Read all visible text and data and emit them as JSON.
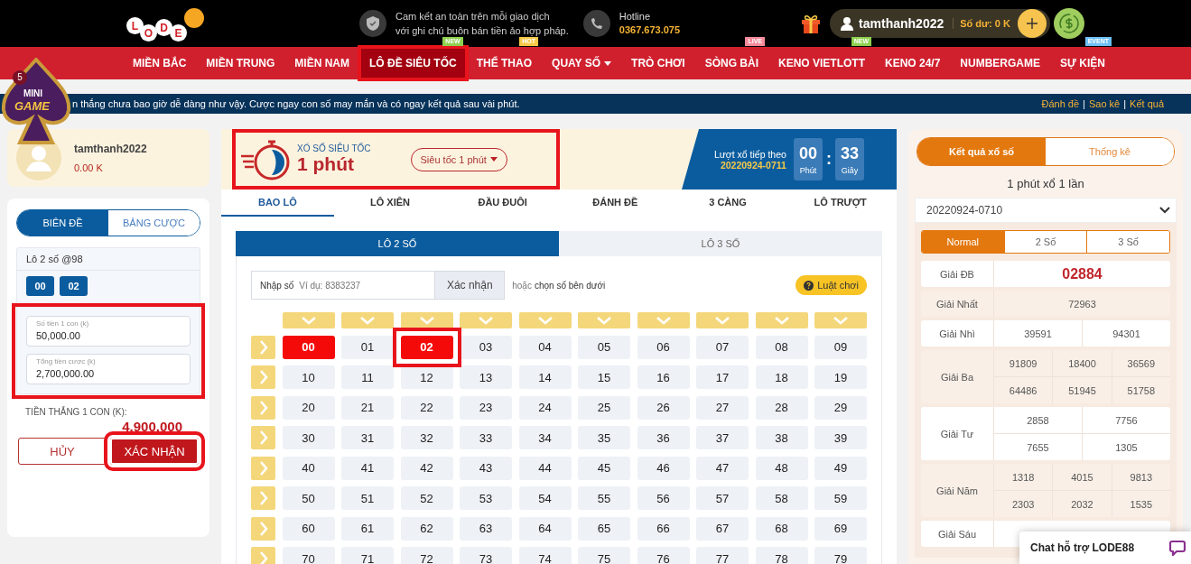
{
  "logo": {
    "letters": [
      "L",
      "O",
      "D",
      "E"
    ]
  },
  "mini_game": {
    "count": "5",
    "label": [
      "MINI",
      "GAME"
    ]
  },
  "header": {
    "notice": [
      "Cam kết an toàn trên mỗi giao dịch",
      "với ghi chú buôn bán tiền ảo hợp pháp."
    ],
    "hotline_label": "Hotline",
    "hotline": "0367.673.075",
    "username": "tamthanh2022",
    "balance": "Số dư: 0 K"
  },
  "nav": [
    {
      "label": "MIỀN BẮC",
      "selected": false,
      "highlighted": false,
      "dropdown": false
    },
    {
      "label": "MIỀN TRUNG",
      "selected": false,
      "highlighted": false,
      "dropdown": false
    },
    {
      "label": "MIỀN NAM",
      "selected": false,
      "highlighted": false,
      "dropdown": false
    },
    {
      "label": "LÔ ĐỀ SIÊU TỐC",
      "selected": true,
      "highlighted": true,
      "dropdown": false,
      "badge": {
        "text": "NEW",
        "color": "#8fd14f"
      }
    },
    {
      "label": "THỂ THAO",
      "selected": false,
      "highlighted": false,
      "dropdown": false,
      "badge": {
        "text": "HOT",
        "color": "#f7c948"
      }
    },
    {
      "label": "QUAY SỐ",
      "selected": false,
      "highlighted": false,
      "dropdown": true
    },
    {
      "label": "TRÒ CHƠI",
      "selected": false,
      "highlighted": false,
      "dropdown": false
    },
    {
      "label": "SÒNG BÀI",
      "selected": false,
      "highlighted": false,
      "dropdown": false,
      "badge": {
        "text": "LIVE",
        "color": "#f58a9a"
      }
    },
    {
      "label": "KENO VIETLOTT",
      "selected": false,
      "highlighted": false,
      "dropdown": false,
      "badge": {
        "text": "NEW",
        "color": "#8fd14f"
      }
    },
    {
      "label": "KENO 24/7",
      "selected": false,
      "highlighted": false,
      "dropdown": false
    },
    {
      "label": "NUMBERGAME",
      "selected": false,
      "highlighted": false,
      "dropdown": false
    },
    {
      "label": "SỰ KIỆN",
      "selected": false,
      "highlighted": false,
      "dropdown": false,
      "badge": {
        "text": "EVENT",
        "color": "#6ec1f5"
      }
    }
  ],
  "marquee": {
    "text": "n thắng chưa bao giờ dễ dàng như vậy. Cược ngay con số may mắn và có ngay kết quả sau vài phút.",
    "links": [
      "Đánh đề",
      "Sao kê",
      "Kết quả"
    ],
    "separator": "|"
  },
  "profile": {
    "username": "tamthanh2022",
    "balance": "0.00 K"
  },
  "bet_panel": {
    "tabs": [
      {
        "label": "BIÊN ĐỀ",
        "selected": true
      },
      {
        "label": "BẢNG CƯỢC",
        "selected": false
      }
    ],
    "title": "Lô 2 số @98",
    "chosen": [
      "00",
      "02"
    ],
    "fields_highlighted": true,
    "fields": [
      {
        "label": "Số tiền 1 con (k)",
        "value": "50,000.00"
      },
      {
        "label": "Tổng tiền cược (k)",
        "value": "2,700,000.00"
      }
    ],
    "win_label": "TIỀN THẮNG 1 CON (K):",
    "win_amount": "4.900.000",
    "cancel": "HỦY",
    "confirm": {
      "label": "XÁC NHẬN",
      "highlighted": true
    }
  },
  "game": {
    "highlighted": true,
    "kicker": "XỔ SỐ SIÊU TỐC",
    "title": "1 phút",
    "mode": "Siêu tốc 1 phút",
    "next_label": "Lượt xổ tiếp theo",
    "next_id": "20220924-0711",
    "countdown": [
      {
        "value": "00",
        "unit": "Phút"
      },
      {
        "value": "33",
        "unit": "Giây"
      }
    ],
    "countdown_separator": ":"
  },
  "bet_tabs": [
    {
      "label": "BAO LÔ",
      "selected": true
    },
    {
      "label": "LÔ XIÊN",
      "selected": false
    },
    {
      "label": "ĐẦU ĐUÔI",
      "selected": false
    },
    {
      "label": "ĐÁNH ĐỀ",
      "selected": false
    },
    {
      "label": "3 CÀNG",
      "selected": false
    },
    {
      "label": "LÔ TRƯỢT",
      "selected": false
    }
  ],
  "sub_tabs": [
    {
      "label": "LÔ 2 SỐ",
      "selected": true
    },
    {
      "label": "LÔ 3 SỐ",
      "selected": false
    }
  ],
  "entry": {
    "label": "Nhập số",
    "placeholder": "Ví dụ: 8383237",
    "button": "Xác nhận",
    "hint": "hoặc",
    "hint_strong": "chọn số bên dưới",
    "rules": "Luật chơi"
  },
  "grid": [
    [
      {
        "n": "00",
        "selected": true,
        "highlighted": false
      },
      {
        "n": "01",
        "selected": false,
        "highlighted": false
      },
      {
        "n": "02",
        "selected": true,
        "highlighted": true
      },
      {
        "n": "03",
        "selected": false,
        "highlighted": false
      },
      {
        "n": "04",
        "selected": false,
        "highlighted": false
      },
      {
        "n": "05",
        "selected": false,
        "highlighted": false
      },
      {
        "n": "06",
        "selected": false,
        "highlighted": false
      },
      {
        "n": "07",
        "selected": false,
        "highlighted": false
      },
      {
        "n": "08",
        "selected": false,
        "highlighted": false
      },
      {
        "n": "09",
        "selected": false,
        "highlighted": false
      }
    ],
    [
      {
        "n": "10",
        "selected": false,
        "highlighted": false
      },
      {
        "n": "11",
        "selected": false,
        "highlighted": false
      },
      {
        "n": "12",
        "selected": false,
        "highlighted": false
      },
      {
        "n": "13",
        "selected": false,
        "highlighted": false
      },
      {
        "n": "14",
        "selected": false,
        "highlighted": false
      },
      {
        "n": "15",
        "selected": false,
        "highlighted": false
      },
      {
        "n": "16",
        "selected": false,
        "highlighted": false
      },
      {
        "n": "17",
        "selected": false,
        "highlighted": false
      },
      {
        "n": "18",
        "selected": false,
        "highlighted": false
      },
      {
        "n": "19",
        "selected": false,
        "highlighted": false
      }
    ],
    [
      {
        "n": "20",
        "selected": false,
        "highlighted": false
      },
      {
        "n": "21",
        "selected": false,
        "highlighted": false
      },
      {
        "n": "22",
        "selected": false,
        "highlighted": false
      },
      {
        "n": "23",
        "selected": false,
        "highlighted": false
      },
      {
        "n": "24",
        "selected": false,
        "highlighted": false
      },
      {
        "n": "25",
        "selected": false,
        "highlighted": false
      },
      {
        "n": "26",
        "selected": false,
        "highlighted": false
      },
      {
        "n": "27",
        "selected": false,
        "highlighted": false
      },
      {
        "n": "28",
        "selected": false,
        "highlighted": false
      },
      {
        "n": "29",
        "selected": false,
        "highlighted": false
      }
    ],
    [
      {
        "n": "30",
        "selected": false,
        "highlighted": false
      },
      {
        "n": "31",
        "selected": false,
        "highlighted": false
      },
      {
        "n": "32",
        "selected": false,
        "highlighted": false
      },
      {
        "n": "33",
        "selected": false,
        "highlighted": false
      },
      {
        "n": "34",
        "selected": false,
        "highlighted": false
      },
      {
        "n": "35",
        "selected": false,
        "highlighted": false
      },
      {
        "n": "36",
        "selected": false,
        "highlighted": false
      },
      {
        "n": "37",
        "selected": false,
        "highlighted": false
      },
      {
        "n": "38",
        "selected": false,
        "highlighted": false
      },
      {
        "n": "39",
        "selected": false,
        "highlighted": false
      }
    ],
    [
      {
        "n": "40",
        "selected": false,
        "highlighted": false
      },
      {
        "n": "41",
        "selected": false,
        "highlighted": false
      },
      {
        "n": "42",
        "selected": false,
        "highlighted": false
      },
      {
        "n": "43",
        "selected": false,
        "highlighted": false
      },
      {
        "n": "44",
        "selected": false,
        "highlighted": false
      },
      {
        "n": "45",
        "selected": false,
        "highlighted": false
      },
      {
        "n": "46",
        "selected": false,
        "highlighted": false
      },
      {
        "n": "47",
        "selected": false,
        "highlighted": false
      },
      {
        "n": "48",
        "selected": false,
        "highlighted": false
      },
      {
        "n": "49",
        "selected": false,
        "highlighted": false
      }
    ],
    [
      {
        "n": "50",
        "selected": false,
        "highlighted": false
      },
      {
        "n": "51",
        "selected": false,
        "highlighted": false
      },
      {
        "n": "52",
        "selected": false,
        "highlighted": false
      },
      {
        "n": "53",
        "selected": false,
        "highlighted": false
      },
      {
        "n": "54",
        "selected": false,
        "highlighted": false
      },
      {
        "n": "55",
        "selected": false,
        "highlighted": false
      },
      {
        "n": "56",
        "selected": false,
        "highlighted": false
      },
      {
        "n": "57",
        "selected": false,
        "highlighted": false
      },
      {
        "n": "58",
        "selected": false,
        "highlighted": false
      },
      {
        "n": "59",
        "selected": false,
        "highlighted": false
      }
    ],
    [
      {
        "n": "60",
        "selected": false,
        "highlighted": false
      },
      {
        "n": "61",
        "selected": false,
        "highlighted": false
      },
      {
        "n": "62",
        "selected": false,
        "highlighted": false
      },
      {
        "n": "63",
        "selected": false,
        "highlighted": false
      },
      {
        "n": "64",
        "selected": false,
        "highlighted": false
      },
      {
        "n": "65",
        "selected": false,
        "highlighted": false
      },
      {
        "n": "66",
        "selected": false,
        "highlighted": false
      },
      {
        "n": "67",
        "selected": false,
        "highlighted": false
      },
      {
        "n": "68",
        "selected": false,
        "highlighted": false
      },
      {
        "n": "69",
        "selected": false,
        "highlighted": false
      }
    ],
    [
      {
        "n": "70",
        "selected": false,
        "highlighted": false
      },
      {
        "n": "71",
        "selected": false,
        "highlighted": false
      },
      {
        "n": "72",
        "selected": false,
        "highlighted": false
      },
      {
        "n": "73",
        "selected": false,
        "highlighted": false
      },
      {
        "n": "74",
        "selected": false,
        "highlighted": false
      },
      {
        "n": "75",
        "selected": false,
        "highlighted": false
      },
      {
        "n": "76",
        "selected": false,
        "highlighted": false
      },
      {
        "n": "77",
        "selected": false,
        "highlighted": false
      },
      {
        "n": "78",
        "selected": false,
        "highlighted": false
      },
      {
        "n": "79",
        "selected": false,
        "highlighted": false
      }
    ]
  ],
  "results": {
    "tabs": [
      {
        "label": "Kết quả xổ số",
        "selected": true
      },
      {
        "label": "Thống kê",
        "selected": false
      }
    ],
    "frequency": "1 phút xổ 1 lần",
    "draw": "20220924-0710",
    "modes": [
      {
        "label": "Normal",
        "selected": true
      },
      {
        "label": "2 Số",
        "selected": false
      },
      {
        "label": "3 Số",
        "selected": false
      }
    ],
    "prizes": [
      {
        "label": "Giải ĐB",
        "kind": "special",
        "rows": [
          [
            "02884"
          ]
        ]
      },
      {
        "label": "Giải Nhất",
        "kind": "normal",
        "rows": [
          [
            "72963"
          ]
        ]
      },
      {
        "label": "Giải Nhì",
        "kind": "normal",
        "rows": [
          [
            "39591",
            "94301"
          ]
        ]
      },
      {
        "label": "Giải Ba",
        "kind": "normal",
        "rows": [
          [
            "91809",
            "18400",
            "36569"
          ],
          [
            "64486",
            "51945",
            "51758"
          ]
        ]
      },
      {
        "label": "Giải Tư",
        "kind": "normal",
        "rows": [
          [
            "2858",
            "7756"
          ],
          [
            "7655",
            "1305"
          ]
        ]
      },
      {
        "label": "Giải Năm",
        "kind": "normal",
        "rows": [
          [
            "1318",
            "4015",
            "9813"
          ],
          [
            "2303",
            "2032",
            "1535"
          ]
        ]
      },
      {
        "label": "Giải Sáu",
        "kind": "normal"
      }
    ]
  },
  "chat": {
    "label": "Chat hỗ trợ LODE88"
  }
}
